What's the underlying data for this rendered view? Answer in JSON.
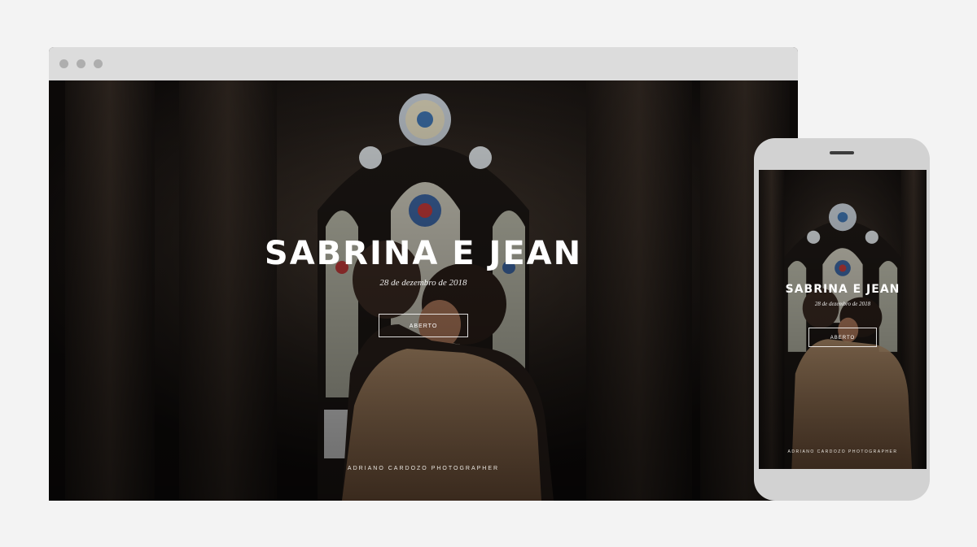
{
  "colors": {
    "page_background": "#f3f3f3",
    "browser_bar": "#dcdcdc",
    "phone_body": "#d2d2d2",
    "overlay_text": "#ffffff"
  },
  "desktop": {
    "window_controls": [
      "dot-icon",
      "dot-icon",
      "dot-icon"
    ],
    "hero": {
      "title": "SABRINA E JEAN",
      "date": "28 de dezembro de 2018",
      "button_label": "ABERTO",
      "credit": "ADRIANO CARDOZO PHOTOGRAPHER"
    }
  },
  "mobile": {
    "hero": {
      "title": "SABRINA E JEAN",
      "date": "28 de dezembro de 2018",
      "button_label": "ABERTO",
      "credit": "ADRIANO CARDOZO PHOTOGRAPHER"
    }
  }
}
